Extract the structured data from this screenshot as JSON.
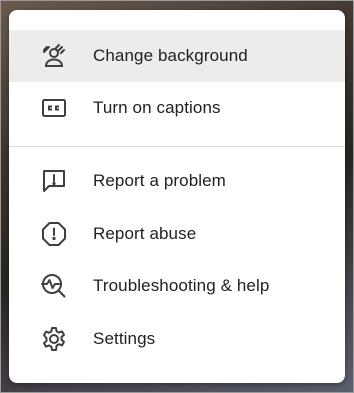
{
  "menu": {
    "items": [
      {
        "label": "Change background",
        "icon": "change-background-icon"
      },
      {
        "label": "Turn on captions",
        "icon": "captions-icon"
      },
      {
        "label": "Report a problem",
        "icon": "report-problem-icon"
      },
      {
        "label": "Report abuse",
        "icon": "report-abuse-icon"
      },
      {
        "label": "Troubleshooting & help",
        "icon": "troubleshooting-icon"
      },
      {
        "label": "Settings",
        "icon": "gear-icon"
      }
    ]
  },
  "colors": {
    "text": "#202124",
    "icon": "#3c4043",
    "highlight": "#ececec",
    "divider": "#dadce0"
  }
}
